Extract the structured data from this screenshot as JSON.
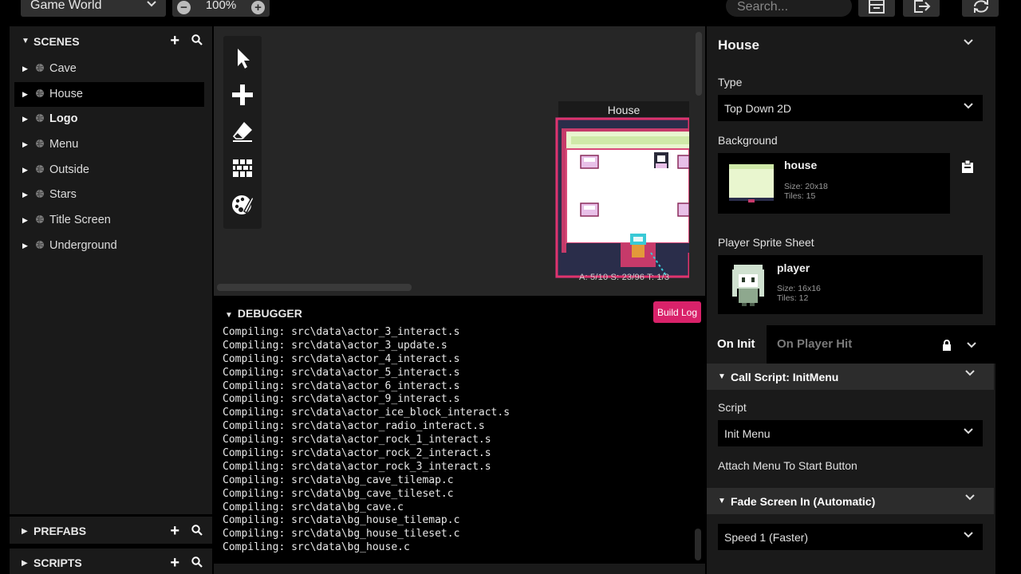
{
  "toolbar": {
    "world_select": "Game World",
    "zoom_value": "100%",
    "zoom_out": "−",
    "zoom_in": "+",
    "search_placeholder": "Search...",
    "icons": [
      "window-icon",
      "export-icon",
      "refresh-icon"
    ]
  },
  "sidebar": {
    "scenes_title": "SCENES",
    "scenes": [
      {
        "label": "Cave",
        "selected": false,
        "bold": false
      },
      {
        "label": "House",
        "selected": true,
        "bold": false
      },
      {
        "label": "Logo",
        "selected": false,
        "bold": true
      },
      {
        "label": "Menu",
        "selected": false,
        "bold": false
      },
      {
        "label": "Outside",
        "selected": false,
        "bold": false
      },
      {
        "label": "Stars",
        "selected": false,
        "bold": false
      },
      {
        "label": "Title Screen",
        "selected": false,
        "bold": false
      },
      {
        "label": "Underground",
        "selected": false,
        "bold": false
      }
    ],
    "prefabs_title": "PREFABS",
    "scripts_title": "SCRIPTS"
  },
  "canvas": {
    "tools": [
      "select-tool",
      "add-tool",
      "eraser-tool",
      "collision-tool",
      "paint-tool"
    ],
    "scene_title": "House",
    "status": "A: 5/10    S: 23/96    T: 1/3"
  },
  "debugger": {
    "title": "DEBUGGER",
    "build_log_label": "Build Log",
    "log_lines": [
      "Compiling: src\\data\\actor_3_interact.s",
      "Compiling: src\\data\\actor_3_update.s",
      "Compiling: src\\data\\actor_4_interact.s",
      "Compiling: src\\data\\actor_5_interact.s",
      "Compiling: src\\data\\actor_6_interact.s",
      "Compiling: src\\data\\actor_9_interact.s",
      "Compiling: src\\data\\actor_ice_block_interact.s",
      "Compiling: src\\data\\actor_radio_interact.s",
      "Compiling: src\\data\\actor_rock_1_interact.s",
      "Compiling: src\\data\\actor_rock_2_interact.s",
      "Compiling: src\\data\\actor_rock_3_interact.s",
      "Compiling: src\\data\\bg_cave_tilemap.c",
      "Compiling: src\\data\\bg_cave_tileset.c",
      "Compiling: src\\data\\bg_cave.c",
      "Compiling: src\\data\\bg_house_tilemap.c",
      "Compiling: src\\data\\bg_house_tileset.c",
      "Compiling: src\\data\\bg_house.c"
    ]
  },
  "inspector": {
    "title": "House",
    "type_label": "Type",
    "type_value": "Top Down 2D",
    "background_label": "Background",
    "background": {
      "name": "house",
      "size": "Size:  20x18",
      "tiles": "Tiles:  15"
    },
    "sprite_label": "Player Sprite Sheet",
    "sprite": {
      "name": "player",
      "size": "Size:  16x16",
      "tiles": "Tiles:  12"
    },
    "tabs": [
      {
        "label": "On Init",
        "active": true
      },
      {
        "label": "On Player Hit",
        "active": false
      }
    ],
    "events": [
      {
        "title": "Call Script: InitMenu",
        "field_label": "Script",
        "field_value": "Init Menu",
        "note": "Attach Menu To Start Button"
      },
      {
        "title": "Fade Screen In (Automatic)",
        "field_value": "Speed 1 (Faster)"
      }
    ]
  },
  "colors": {
    "accent": "#d9226a",
    "panel": "#1a1a1a",
    "canvas": "#262626",
    "scene_wall": "#e0336c",
    "scene_floor": "#f0fbe0"
  }
}
